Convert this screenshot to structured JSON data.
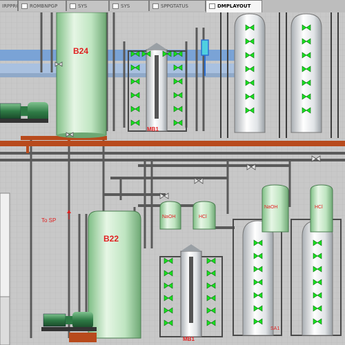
{
  "tabs": [
    {
      "label": "IRPPROTOT"
    },
    {
      "label": "ROMBNPGP"
    },
    {
      "label": "SYS"
    },
    {
      "label": "SYS"
    },
    {
      "label": "SPPGTATUS"
    },
    {
      "label": "DMPLAYOUT"
    }
  ],
  "active_tab_index": 5,
  "tanks": {
    "b24": {
      "label": "B24"
    },
    "b22": {
      "label": "B22"
    }
  },
  "chemicals": {
    "naoh_top": "NaOH",
    "hcl_top": "HCl",
    "naoh_mid": "NaOH",
    "hcl_mid": "HCl"
  },
  "units": {
    "mb_upper": "MB1",
    "mb_lower": "MB1",
    "label_lower_right": "SA1"
  },
  "pipe_label": "To SP",
  "colors": {
    "pipe_main": "#b84a1c",
    "pipe_blue": "#2c6fd0",
    "valve_open": "#19e21f",
    "vessel": "#e9ecef",
    "tank": "#bfe5c1",
    "label_red": "#e02020"
  }
}
